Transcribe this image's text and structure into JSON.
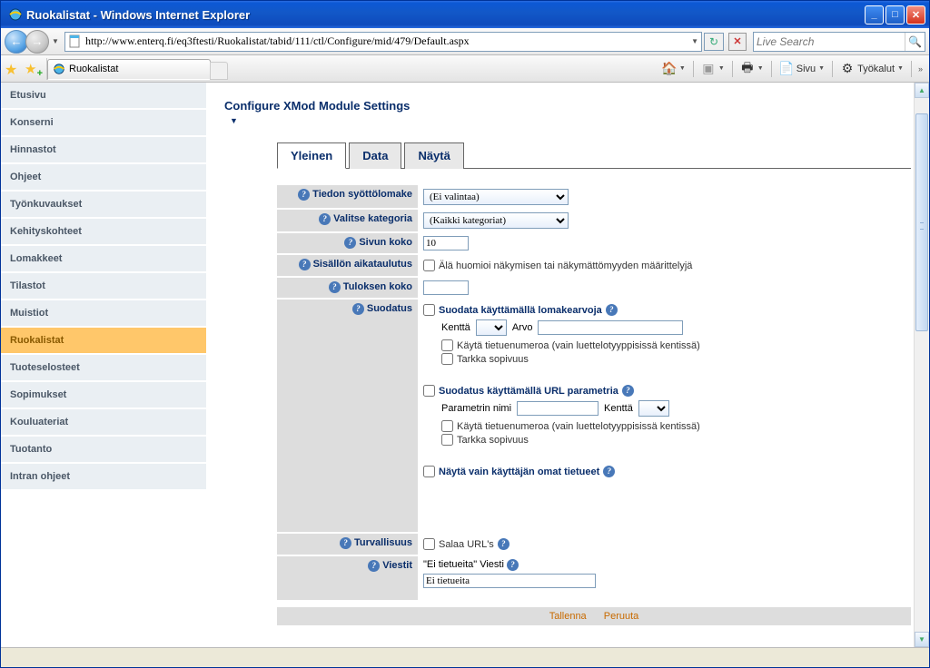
{
  "window": {
    "title": "Ruokalistat - Windows Internet Explorer"
  },
  "address": {
    "url": "http://www.enterq.fi/eq3ftesti/Ruokalistat/tabid/111/ctl/Configure/mid/479/Default.aspx"
  },
  "search": {
    "placeholder": "Live Search"
  },
  "tab": {
    "label": "Ruokalistat"
  },
  "toolbar": {
    "page_label": "Sivu",
    "tools_label": "Työkalut"
  },
  "sidebar": {
    "items": [
      {
        "label": "Etusivu"
      },
      {
        "label": "Konserni"
      },
      {
        "label": "Hinnastot"
      },
      {
        "label": "Ohjeet"
      },
      {
        "label": "Työnkuvaukset"
      },
      {
        "label": "Kehityskohteet"
      },
      {
        "label": "Lomakkeet"
      },
      {
        "label": "Tilastot"
      },
      {
        "label": "Muistiot"
      },
      {
        "label": "Ruokalistat"
      },
      {
        "label": "Tuoteselosteet"
      },
      {
        "label": "Sopimukset"
      },
      {
        "label": "Kouluateriat"
      },
      {
        "label": "Tuotanto"
      },
      {
        "label": "Intran ohjeet"
      }
    ],
    "active_index": 9
  },
  "page": {
    "title": "Configure XMod Module Settings",
    "tabs": [
      {
        "label": "Yleinen"
      },
      {
        "label": "Data"
      },
      {
        "label": "Näytä"
      }
    ],
    "active_tab": 0
  },
  "form": {
    "data_entry_form": {
      "label": "Tiedon syöttölomake",
      "value": "(Ei valintaa)"
    },
    "category": {
      "label": "Valitse kategoria",
      "value": "(Kaikki kategoriat)"
    },
    "page_size": {
      "label": "Sivun koko",
      "value": "10"
    },
    "scheduling": {
      "label": "Sisällön aikataulutus",
      "checkbox": "Älä huomioi näkymisen tai näkymättömyyden määrittelyjä"
    },
    "result_size": {
      "label": "Tuloksen koko",
      "value": ""
    },
    "filtering": {
      "label": "Suodatus",
      "by_form": "Suodata käyttämällä lomakearvoja",
      "field_label": "Kenttä",
      "value_label": "Arvo",
      "use_record_number": "Käytä tietuenumeroa (vain luettelotyyppisissä kentissä)",
      "exact_match": "Tarkka sopivuus",
      "by_url": "Suodatus käyttämällä URL parametria",
      "param_name_label": "Parametrin nimi",
      "show_own": "Näytä vain käyttäjän omat tietueet"
    },
    "security": {
      "label": "Turvallisuus",
      "checkbox": "Salaa URL's"
    },
    "messages": {
      "label": "Viestit",
      "no_records_label": "\"Ei tietueita\" Viesti",
      "no_records_value": "Ei tietueita"
    }
  },
  "actions": {
    "save": "Tallenna",
    "cancel": "Peruuta"
  }
}
